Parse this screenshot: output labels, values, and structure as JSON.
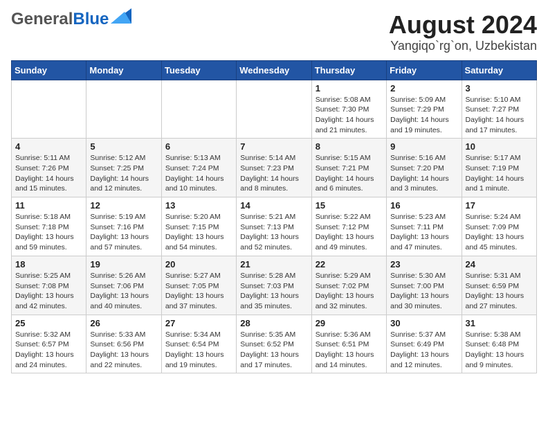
{
  "header": {
    "logo_general": "General",
    "logo_blue": "Blue",
    "title": "August 2024",
    "subtitle": "Yangiqo`rg`on, Uzbekistan"
  },
  "days_of_week": [
    "Sunday",
    "Monday",
    "Tuesday",
    "Wednesday",
    "Thursday",
    "Friday",
    "Saturday"
  ],
  "weeks": [
    [
      {
        "day": "",
        "info": ""
      },
      {
        "day": "",
        "info": ""
      },
      {
        "day": "",
        "info": ""
      },
      {
        "day": "",
        "info": ""
      },
      {
        "day": "1",
        "info": "Sunrise: 5:08 AM\nSunset: 7:30 PM\nDaylight: 14 hours\nand 21 minutes."
      },
      {
        "day": "2",
        "info": "Sunrise: 5:09 AM\nSunset: 7:29 PM\nDaylight: 14 hours\nand 19 minutes."
      },
      {
        "day": "3",
        "info": "Sunrise: 5:10 AM\nSunset: 7:27 PM\nDaylight: 14 hours\nand 17 minutes."
      }
    ],
    [
      {
        "day": "4",
        "info": "Sunrise: 5:11 AM\nSunset: 7:26 PM\nDaylight: 14 hours\nand 15 minutes."
      },
      {
        "day": "5",
        "info": "Sunrise: 5:12 AM\nSunset: 7:25 PM\nDaylight: 14 hours\nand 12 minutes."
      },
      {
        "day": "6",
        "info": "Sunrise: 5:13 AM\nSunset: 7:24 PM\nDaylight: 14 hours\nand 10 minutes."
      },
      {
        "day": "7",
        "info": "Sunrise: 5:14 AM\nSunset: 7:23 PM\nDaylight: 14 hours\nand 8 minutes."
      },
      {
        "day": "8",
        "info": "Sunrise: 5:15 AM\nSunset: 7:21 PM\nDaylight: 14 hours\nand 6 minutes."
      },
      {
        "day": "9",
        "info": "Sunrise: 5:16 AM\nSunset: 7:20 PM\nDaylight: 14 hours\nand 3 minutes."
      },
      {
        "day": "10",
        "info": "Sunrise: 5:17 AM\nSunset: 7:19 PM\nDaylight: 14 hours\nand 1 minute."
      }
    ],
    [
      {
        "day": "11",
        "info": "Sunrise: 5:18 AM\nSunset: 7:18 PM\nDaylight: 13 hours\nand 59 minutes."
      },
      {
        "day": "12",
        "info": "Sunrise: 5:19 AM\nSunset: 7:16 PM\nDaylight: 13 hours\nand 57 minutes."
      },
      {
        "day": "13",
        "info": "Sunrise: 5:20 AM\nSunset: 7:15 PM\nDaylight: 13 hours\nand 54 minutes."
      },
      {
        "day": "14",
        "info": "Sunrise: 5:21 AM\nSunset: 7:13 PM\nDaylight: 13 hours\nand 52 minutes."
      },
      {
        "day": "15",
        "info": "Sunrise: 5:22 AM\nSunset: 7:12 PM\nDaylight: 13 hours\nand 49 minutes."
      },
      {
        "day": "16",
        "info": "Sunrise: 5:23 AM\nSunset: 7:11 PM\nDaylight: 13 hours\nand 47 minutes."
      },
      {
        "day": "17",
        "info": "Sunrise: 5:24 AM\nSunset: 7:09 PM\nDaylight: 13 hours\nand 45 minutes."
      }
    ],
    [
      {
        "day": "18",
        "info": "Sunrise: 5:25 AM\nSunset: 7:08 PM\nDaylight: 13 hours\nand 42 minutes."
      },
      {
        "day": "19",
        "info": "Sunrise: 5:26 AM\nSunset: 7:06 PM\nDaylight: 13 hours\nand 40 minutes."
      },
      {
        "day": "20",
        "info": "Sunrise: 5:27 AM\nSunset: 7:05 PM\nDaylight: 13 hours\nand 37 minutes."
      },
      {
        "day": "21",
        "info": "Sunrise: 5:28 AM\nSunset: 7:03 PM\nDaylight: 13 hours\nand 35 minutes."
      },
      {
        "day": "22",
        "info": "Sunrise: 5:29 AM\nSunset: 7:02 PM\nDaylight: 13 hours\nand 32 minutes."
      },
      {
        "day": "23",
        "info": "Sunrise: 5:30 AM\nSunset: 7:00 PM\nDaylight: 13 hours\nand 30 minutes."
      },
      {
        "day": "24",
        "info": "Sunrise: 5:31 AM\nSunset: 6:59 PM\nDaylight: 13 hours\nand 27 minutes."
      }
    ],
    [
      {
        "day": "25",
        "info": "Sunrise: 5:32 AM\nSunset: 6:57 PM\nDaylight: 13 hours\nand 24 minutes."
      },
      {
        "day": "26",
        "info": "Sunrise: 5:33 AM\nSunset: 6:56 PM\nDaylight: 13 hours\nand 22 minutes."
      },
      {
        "day": "27",
        "info": "Sunrise: 5:34 AM\nSunset: 6:54 PM\nDaylight: 13 hours\nand 19 minutes."
      },
      {
        "day": "28",
        "info": "Sunrise: 5:35 AM\nSunset: 6:52 PM\nDaylight: 13 hours\nand 17 minutes."
      },
      {
        "day": "29",
        "info": "Sunrise: 5:36 AM\nSunset: 6:51 PM\nDaylight: 13 hours\nand 14 minutes."
      },
      {
        "day": "30",
        "info": "Sunrise: 5:37 AM\nSunset: 6:49 PM\nDaylight: 13 hours\nand 12 minutes."
      },
      {
        "day": "31",
        "info": "Sunrise: 5:38 AM\nSunset: 6:48 PM\nDaylight: 13 hours\nand 9 minutes."
      }
    ]
  ]
}
